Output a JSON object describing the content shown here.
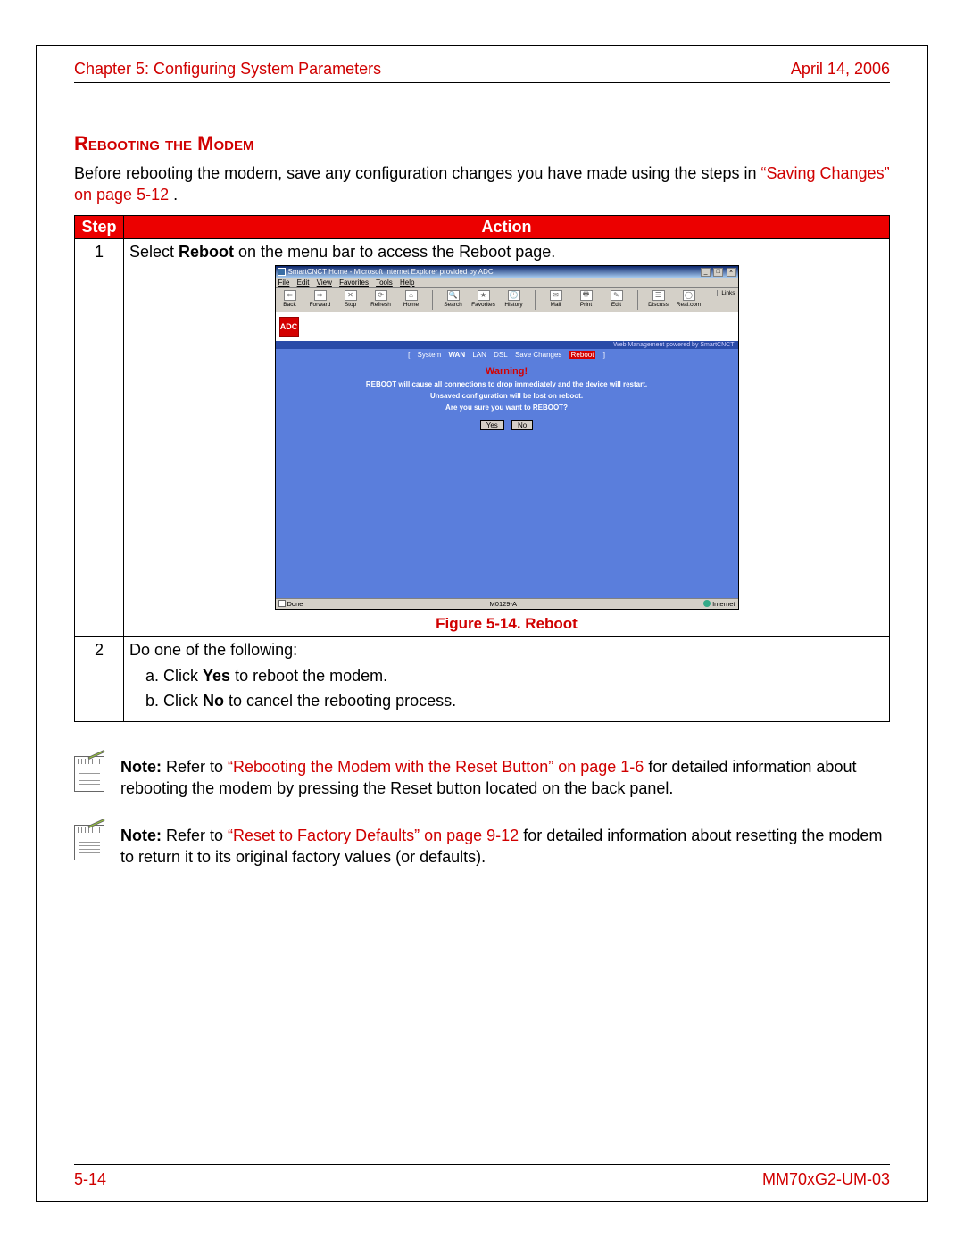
{
  "header": {
    "chapter": "Chapter 5: Configuring System Parameters",
    "date": "April 14, 2006"
  },
  "section": {
    "title": "Rebooting the Modem",
    "intro_prefix": "Before rebooting the modem, save any configuration changes you have made using the steps in ",
    "intro_link": "“Saving Changes” on page 5-12",
    "intro_suffix": "."
  },
  "table": {
    "head_step": "Step",
    "head_action": "Action",
    "row1": {
      "num": "1",
      "line_prefix": "Select ",
      "line_bold": "Reboot",
      "line_suffix": " on the menu bar to access the Reboot page.",
      "figure_caption": "Figure 5-14. Reboot"
    },
    "row2": {
      "num": "2",
      "lead": "Do one of the following:",
      "a_prefix": "a. Click ",
      "a_bold": "Yes",
      "a_suffix": " to reboot the modem.",
      "b_prefix": "b. Click ",
      "b_bold": "No",
      "b_suffix": " to cancel the rebooting process."
    }
  },
  "screenshot": {
    "title": "SmartCNCT Home - Microsoft Internet Explorer provided by ADC",
    "menus": [
      "File",
      "Edit",
      "View",
      "Favorites",
      "Tools",
      "Help"
    ],
    "toolbar": [
      "Back",
      "Forward",
      "Stop",
      "Refresh",
      "Home",
      "Search",
      "Favorites",
      "History",
      "Mail",
      "Print",
      "Edit",
      "Discuss",
      "Real.com"
    ],
    "toolbar_right": "Links",
    "logo": "ADC",
    "strip_text": "Web Management powered by SmartCNCT",
    "nav": {
      "open": "[",
      "items": [
        "System",
        "WAN",
        "LAN",
        "DSL",
        "Save Changes",
        "Reboot"
      ],
      "close": "]"
    },
    "warning_title": "Warning!",
    "warning_lines": [
      "REBOOT will cause all connections to drop immediately and the device will restart.",
      "Unsaved configuration will be lost on reboot.",
      "Are you sure you want to REBOOT?"
    ],
    "buttons": {
      "yes": "Yes",
      "no": "No"
    },
    "status_left": "Done",
    "status_mid": "M0129-A",
    "status_right": "Internet"
  },
  "notes": {
    "n1_bold": "Note:",
    "n1_prefix": " Refer to ",
    "n1_link": "“Rebooting the Modem with the Reset Button” on page 1-6",
    "n1_suffix": " for detailed information about rebooting the modem by pressing the Reset button located on the back panel.",
    "n2_bold": "Note:",
    "n2_prefix": " Refer to ",
    "n2_link": "“Reset to Factory Defaults” on page 9-12",
    "n2_suffix": " for detailed information about resetting the modem to return it to its original factory values (or defaults)."
  },
  "footer": {
    "page": "5-14",
    "doc": "MM70xG2-UM-03"
  }
}
